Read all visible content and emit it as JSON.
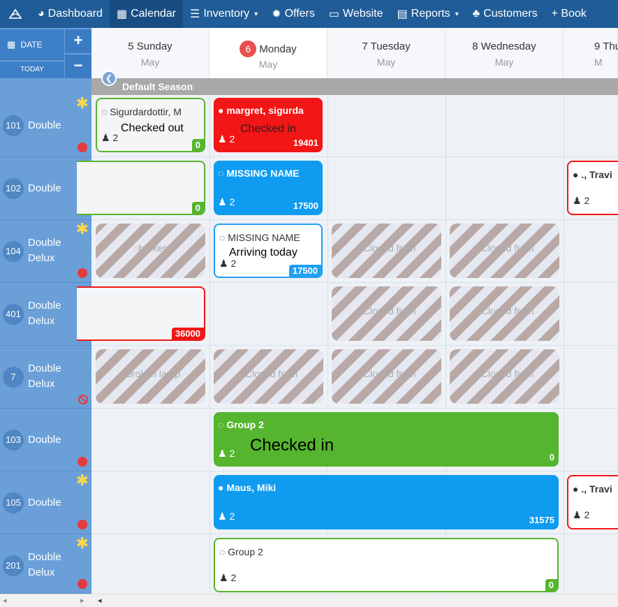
{
  "nav": {
    "dashboard": "Dashboard",
    "calendar": "Calendar",
    "inventory": "Inventory",
    "offers": "Offers",
    "website": "Website",
    "reports": "Reports",
    "customers": "Customers",
    "book": "+ Book"
  },
  "controls": {
    "date": "DATE",
    "today": "TODAY",
    "plus": "+",
    "minus": "−"
  },
  "days": [
    {
      "day": "5 Sunday",
      "month": "May"
    },
    {
      "badge": "6",
      "day": "Monday",
      "month": "May"
    },
    {
      "day": "7 Tuesday",
      "month": "May"
    },
    {
      "day": "8 Wednesday",
      "month": "May"
    },
    {
      "day": "9 Thu",
      "month": "M"
    }
  ],
  "season": "Default Season",
  "rooms": [
    {
      "num": "101",
      "name": "Double"
    },
    {
      "num": "102",
      "name": "Double"
    },
    {
      "num": "104",
      "name": "Double Delux"
    },
    {
      "num": "401",
      "name": "Double Delux"
    },
    {
      "num": "7",
      "name": "Double Delux"
    },
    {
      "num": "103",
      "name": "Double"
    },
    {
      "num": "105",
      "name": "Double"
    },
    {
      "num": "201",
      "name": "Double Delux"
    }
  ],
  "bookings": {
    "b101a": {
      "title": "Sigurdardottir, M",
      "status": "Checked out",
      "people": "2",
      "amount": "0"
    },
    "b101b": {
      "title": "margret, sigurda",
      "status": "Checked in",
      "people": "2",
      "amount": "19401"
    },
    "b102a": {
      "amount": "0"
    },
    "b102b": {
      "title": "MISSING NAME",
      "people": "2",
      "amount": "17500"
    },
    "b102c": {
      "title": "., Travi",
      "people": "2"
    },
    "b104b": {
      "title": "MISSING NAME",
      "status": "Arriving today",
      "people": "2",
      "amount": "17500"
    },
    "b401a": {
      "amount": "36000"
    },
    "b103": {
      "title": "Group 2",
      "status": "Checked in",
      "people": "2",
      "amount": "0"
    },
    "b105": {
      "title": "Maus, Miki",
      "people": "2",
      "amount": "31575"
    },
    "b105c": {
      "title": "., Travi",
      "people": "2"
    },
    "b201": {
      "title": "Group 2",
      "people": "2",
      "amount": "0"
    }
  },
  "closed": {
    "c104a": "broken",
    "c104c": "Closed from",
    "c104d": "Closed from",
    "c401c": "Closed from",
    "c401d": "Closed from",
    "c7a": "broken lamp",
    "c7b": "Closed from",
    "c7c": "Closed from",
    "c7d": "Closed from"
  },
  "colors": {
    "nav": "#1f5c98",
    "blue": "#0f9bf0",
    "red": "#f21616",
    "green": "#55b52e",
    "room": "#6a9fd8"
  }
}
